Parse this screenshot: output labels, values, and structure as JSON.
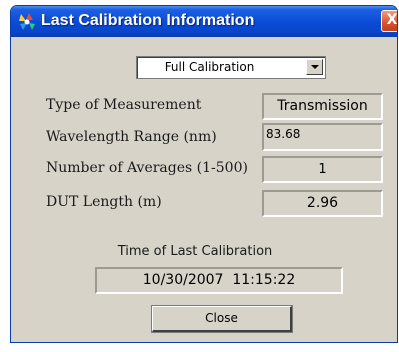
{
  "window": {
    "title": "Last Calibration Information",
    "close_symbol": "X"
  },
  "calibration_type": {
    "selected": "Full Calibration"
  },
  "fields": [
    {
      "label": "Type of Measurement",
      "value": "Transmission"
    },
    {
      "label": "Wavelength Range (nm)",
      "value": "83.68"
    },
    {
      "label": "Number of Averages (1-500)",
      "value": "1"
    },
    {
      "label": "DUT Length (m)",
      "value": "2.96"
    }
  ],
  "last_calibration": {
    "label": "Time of Last Calibration",
    "value": "10/30/2007  11:15:22"
  },
  "buttons": {
    "close_label": "Close"
  },
  "icons": {
    "app": "app-logo-icon",
    "close": "close-icon",
    "dropdown": "chevron-down-icon"
  },
  "colors": {
    "titlebar": "#0a4bd6",
    "dialog_background": "#d7d3c8",
    "close_button": "#d9532e"
  }
}
